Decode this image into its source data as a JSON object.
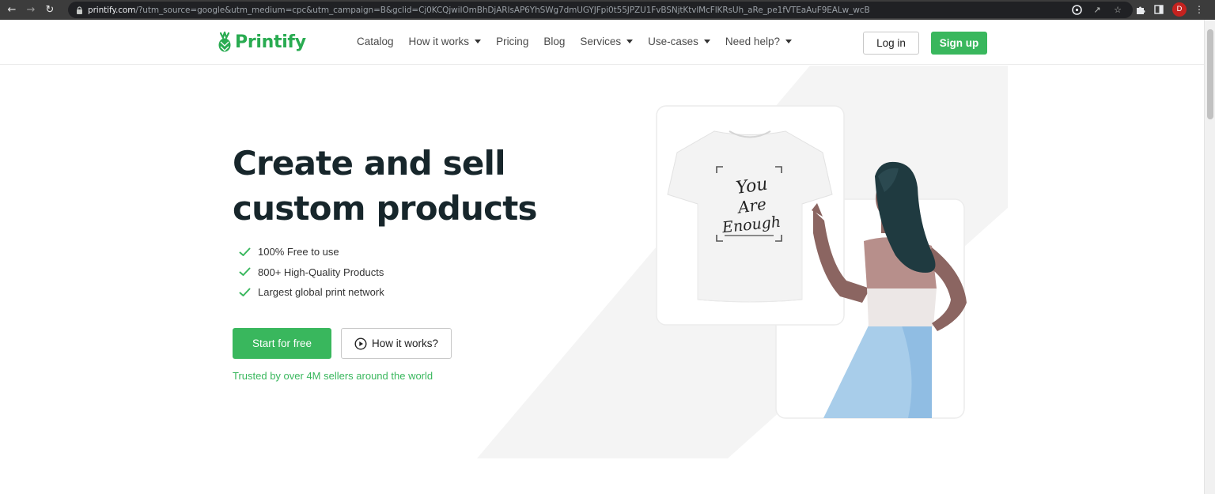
{
  "browser": {
    "url_host": "printify.com",
    "url_path": "/?utm_source=google&utm_medium=cpc&utm_campaign=B&gclid=Cj0KCQjwiIOmBhDjARIsAP6YhSWg7dmUGYJFpi0t55JPZU1FvBSNjtKtvlMcFlKRsUh_aRe_pe1fVTEaAuF9EALw_wcB",
    "avatar_letter": "D"
  },
  "header": {
    "logo_text": "Printify",
    "nav": [
      {
        "label": "Catalog",
        "has_caret": false
      },
      {
        "label": "How it works",
        "has_caret": true
      },
      {
        "label": "Pricing",
        "has_caret": false
      },
      {
        "label": "Blog",
        "has_caret": false
      },
      {
        "label": "Services",
        "has_caret": true
      },
      {
        "label": "Use-cases",
        "has_caret": true
      },
      {
        "label": "Need help?",
        "has_caret": true
      }
    ],
    "login_label": "Log in",
    "signup_label": "Sign up"
  },
  "hero": {
    "title_line1": "Create and sell",
    "title_line2": "custom products",
    "features": [
      "100% Free to use",
      "800+ High-Quality Products",
      "Largest global print network"
    ],
    "start_label": "Start for free",
    "how_label": "How it works?",
    "trusted_text": "Trusted by over 4M sellers around the world",
    "tshirt_print": [
      "You",
      "Are",
      "Enough"
    ]
  },
  "colors": {
    "brand_green": "#39b75d",
    "logo_green": "#29ab51",
    "heading": "#17262b",
    "skirt_blue": "#a8cdea"
  }
}
